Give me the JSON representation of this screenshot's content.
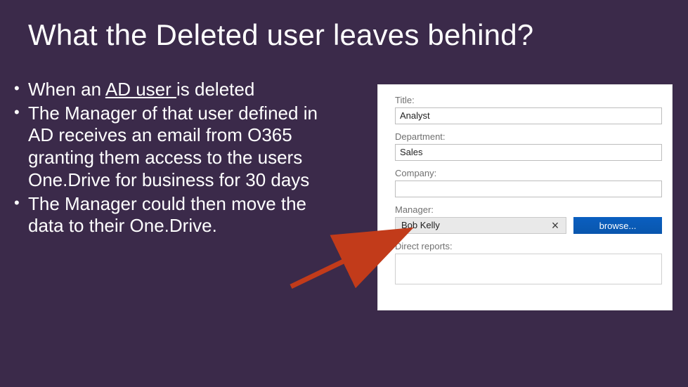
{
  "title": "What the Deleted user leaves behind?",
  "bullets": {
    "b1_prefix": "When an ",
    "b1_underline": "AD user ",
    "b1_suffix": "is deleted",
    "b2": "The Manager of that user defined in AD receives an email from O365 granting them access to the users One.Drive for business for 30 days",
    "b3": "The Manager could then move the data to their One.Drive."
  },
  "form": {
    "title_label": "Title:",
    "title_value": "Analyst",
    "department_label": "Department:",
    "department_value": "Sales",
    "company_label": "Company:",
    "company_value": "",
    "manager_label": "Manager:",
    "manager_value": "Bob Kelly",
    "browse_label": "browse...",
    "direct_reports_label": "Direct reports:"
  }
}
